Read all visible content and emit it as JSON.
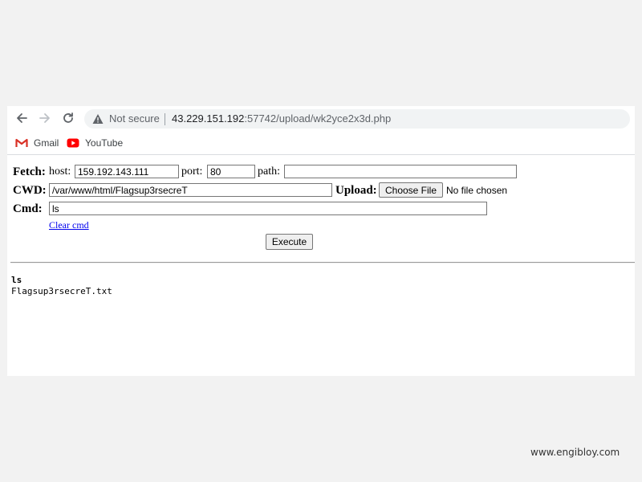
{
  "browser": {
    "security_label": "Not secure",
    "url_host": "43.229.151.192",
    "url_rest": ":57742/upload/wk2yce2x3d.php",
    "bookmarks": [
      {
        "label": "Gmail",
        "icon": "gmail-icon"
      },
      {
        "label": "YouTube",
        "icon": "youtube-icon"
      }
    ]
  },
  "form": {
    "fetch_label": "Fetch:",
    "host_label": "host:",
    "host_value": "159.192.143.111",
    "port_label": "port:",
    "port_value": "80",
    "path_label": "path:",
    "path_value": "",
    "cwd_label": "CWD:",
    "cwd_value": "/var/www/html/Flagsup3rsecreT",
    "upload_label": "Upload:",
    "choose_file_label": "Choose File",
    "no_file_text": "No file chosen",
    "cmd_label": "Cmd:",
    "cmd_value": "ls",
    "clear_cmd_label": "Clear cmd",
    "execute_label": "Execute"
  },
  "output": {
    "command": "ls",
    "result": "Flagsup3rsecreT.txt"
  },
  "watermark": "www.engibloy.com"
}
